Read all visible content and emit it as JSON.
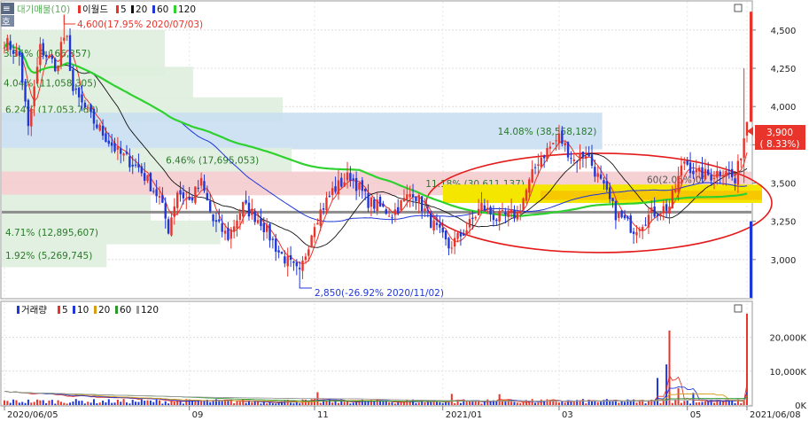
{
  "chart_data": [
    {
      "type": "candlestick",
      "legend": {
        "title": "대기매물(10)",
        "items": [
          {
            "label": "이월드",
            "color": "#e8342a"
          },
          {
            "label": "5",
            "color": "#e8342a"
          },
          {
            "label": "20",
            "color": "#111111"
          },
          {
            "label": "60",
            "color": "#1f37d8"
          },
          {
            "label": "120",
            "color": "#2fd12f"
          }
        ]
      },
      "ylim": [
        2750,
        4650
      ],
      "yticks": [
        {
          "v": 4500,
          "t": "4,500"
        },
        {
          "v": 4250,
          "t": "4,250"
        },
        {
          "v": 4000,
          "t": "4,000"
        },
        {
          "v": 3750,
          "t": "3,750"
        },
        {
          "v": 3500,
          "t": "3,500"
        },
        {
          "v": 3250,
          "t": "3,250"
        },
        {
          "v": 3000,
          "t": "3,000"
        }
      ],
      "current_price": {
        "label": "3,900",
        "change": "( 8.33%)",
        "value": 3900
      },
      "high_annotation": {
        "text": "4,600(17.95% 2020/07/03)",
        "value": 4600
      },
      "low_annotation": {
        "text": "2,850(-26.92% 2020/11/02)",
        "value": 2850
      },
      "volume_profile": [
        {
          "low": 4200,
          "high": 4500,
          "text": "3.35% (9,166,357)",
          "color": "#dfeede"
        },
        {
          "low": 4050,
          "high": 4260,
          "text": "4.04% (11,058,305)",
          "color": "#dfeede"
        },
        {
          "low": 3900,
          "high": 4060,
          "text": "6.24% (17,053,766)",
          "color": "#dfeede"
        },
        {
          "low": 3720,
          "high": 3960,
          "text": "14.08% (38,558,182)",
          "color": "#c9dff2"
        },
        {
          "low": 3570,
          "high": 3730,
          "text": "6.46% (17,695,053)",
          "color": "#dfeede"
        },
        {
          "low": 3420,
          "high": 3575,
          "text": "11.18% (30,611,137)",
          "color": "#f5c9cc"
        },
        {
          "low": 3250,
          "high": 3425,
          "text": "",
          "color": "#dfeede"
        },
        {
          "low": 3100,
          "high": 3255,
          "text": "4.71% (12,895,607)",
          "color": "#dfeede"
        },
        {
          "low": 2950,
          "high": 3105,
          "text": "1.92% (5,269,745)",
          "color": "#dfeede"
        }
      ],
      "support_line": 3310,
      "box_label": "60(2.06%)02"
    },
    {
      "type": "bar",
      "legend": {
        "title": "거래량",
        "items": [
          {
            "label": "5",
            "color": "#e8342a"
          },
          {
            "label": "10",
            "color": "#1f37d8"
          },
          {
            "label": "20",
            "color": "#d79c12"
          },
          {
            "label": "60",
            "color": "#2a9a2a"
          },
          {
            "label": "120",
            "color": "#9a9a9a"
          }
        ]
      },
      "ylim": [
        0,
        28000
      ],
      "yticks": [
        {
          "v": 20000,
          "t": "20,000K"
        },
        {
          "v": 10000,
          "t": "10,000K"
        },
        {
          "v": 0,
          "t": "0K"
        }
      ]
    }
  ],
  "xaxis": {
    "labels": [
      {
        "t": "2020/06/05",
        "x": 0
      },
      {
        "t": "09",
        "x": 62
      },
      {
        "t": "11",
        "x": 104
      },
      {
        "t": "2021/01",
        "x": 147
      },
      {
        "t": "03",
        "x": 186
      },
      {
        "t": "05",
        "x": 229
      },
      {
        "t": "2021/06/08",
        "x": 249
      }
    ]
  },
  "price_series": {
    "anchors": [
      [
        0,
        4430
      ],
      [
        5,
        4330
      ],
      [
        8,
        3850
      ],
      [
        12,
        4380
      ],
      [
        18,
        4250
      ],
      [
        20,
        4600
      ],
      [
        23,
        4100
      ],
      [
        30,
        3900
      ],
      [
        38,
        3700
      ],
      [
        45,
        3600
      ],
      [
        52,
        3400
      ],
      [
        55,
        3200
      ],
      [
        58,
        3450
      ],
      [
        62,
        3380
      ],
      [
        66,
        3500
      ],
      [
        70,
        3250
      ],
      [
        75,
        3150
      ],
      [
        80,
        3350
      ],
      [
        86,
        3250
      ],
      [
        92,
        3050
      ],
      [
        99,
        2900
      ],
      [
        104,
        3250
      ],
      [
        110,
        3450
      ],
      [
        116,
        3550
      ],
      [
        122,
        3380
      ],
      [
        130,
        3300
      ],
      [
        137,
        3450
      ],
      [
        143,
        3250
      ],
      [
        149,
        3080
      ],
      [
        155,
        3200
      ],
      [
        160,
        3350
      ],
      [
        165,
        3270
      ],
      [
        172,
        3300
      ],
      [
        179,
        3650
      ],
      [
        186,
        3800
      ],
      [
        191,
        3650
      ],
      [
        195,
        3700
      ],
      [
        200,
        3500
      ],
      [
        205,
        3300
      ],
      [
        211,
        3200
      ],
      [
        217,
        3300
      ],
      [
        223,
        3350
      ],
      [
        228,
        3650
      ],
      [
        232,
        3560
      ],
      [
        237,
        3550
      ],
      [
        242,
        3600
      ],
      [
        245,
        3500
      ],
      [
        249,
        3900
      ]
    ]
  },
  "volume_spikes": [
    [
      105,
      3800
    ],
    [
      150,
      3300
    ],
    [
      166,
      3200
    ],
    [
      219,
      8000
    ],
    [
      222,
      12000
    ],
    [
      223,
      22000
    ],
    [
      226,
      5000
    ],
    [
      231,
      3600
    ],
    [
      249,
      27000
    ]
  ]
}
